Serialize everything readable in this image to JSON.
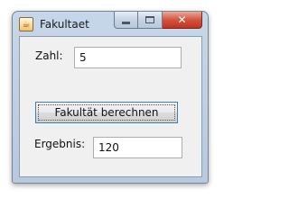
{
  "window": {
    "title": "Fakultaet",
    "icon": "java-coffee-icon",
    "caption_buttons": {
      "minimize": "minimize-icon",
      "maximize": "maximize-icon",
      "close": "close-icon",
      "close_glyph": "✕"
    }
  },
  "form": {
    "input_label": "Zahl:",
    "input_value": "5",
    "button_label": "Fakultät berechnen",
    "result_label": "Ergebnis:",
    "result_value": "120"
  },
  "colors": {
    "frame": "#b7c9df",
    "close_button": "#c2321e",
    "content_bg": "#f0f0f0"
  }
}
